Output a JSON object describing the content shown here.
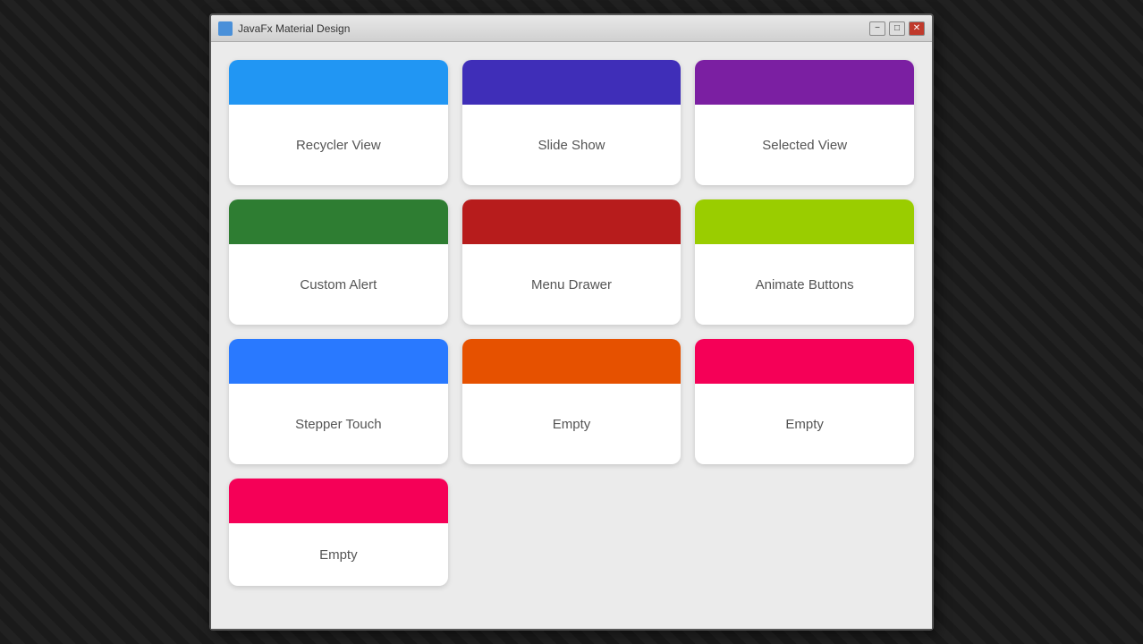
{
  "window": {
    "title": "JavaFx Material Design",
    "min_label": "−",
    "max_label": "□",
    "close_label": "✕"
  },
  "cards": [
    {
      "id": "recycler-view",
      "label": "Recycler View",
      "color": "#2196F3"
    },
    {
      "id": "slide-show",
      "label": "Slide Show",
      "color": "#3F2EB8"
    },
    {
      "id": "selected-view",
      "label": "Selected View",
      "color": "#7B1FA2"
    },
    {
      "id": "custom-alert",
      "label": "Custom Alert",
      "color": "#2E7D32"
    },
    {
      "id": "menu-drawer",
      "label": "Menu Drawer",
      "color": "#B71C1C"
    },
    {
      "id": "animate-buttons",
      "label": "Animate Buttons",
      "color": "#9ACD00"
    },
    {
      "id": "stepper-touch",
      "label": "Stepper Touch",
      "color": "#2979FF"
    },
    {
      "id": "empty-1",
      "label": "Empty",
      "color": "#E65100"
    },
    {
      "id": "empty-2",
      "label": "Empty",
      "color": "#F50057"
    },
    {
      "id": "empty-3",
      "label": "Empty",
      "color": "#F50057"
    }
  ]
}
